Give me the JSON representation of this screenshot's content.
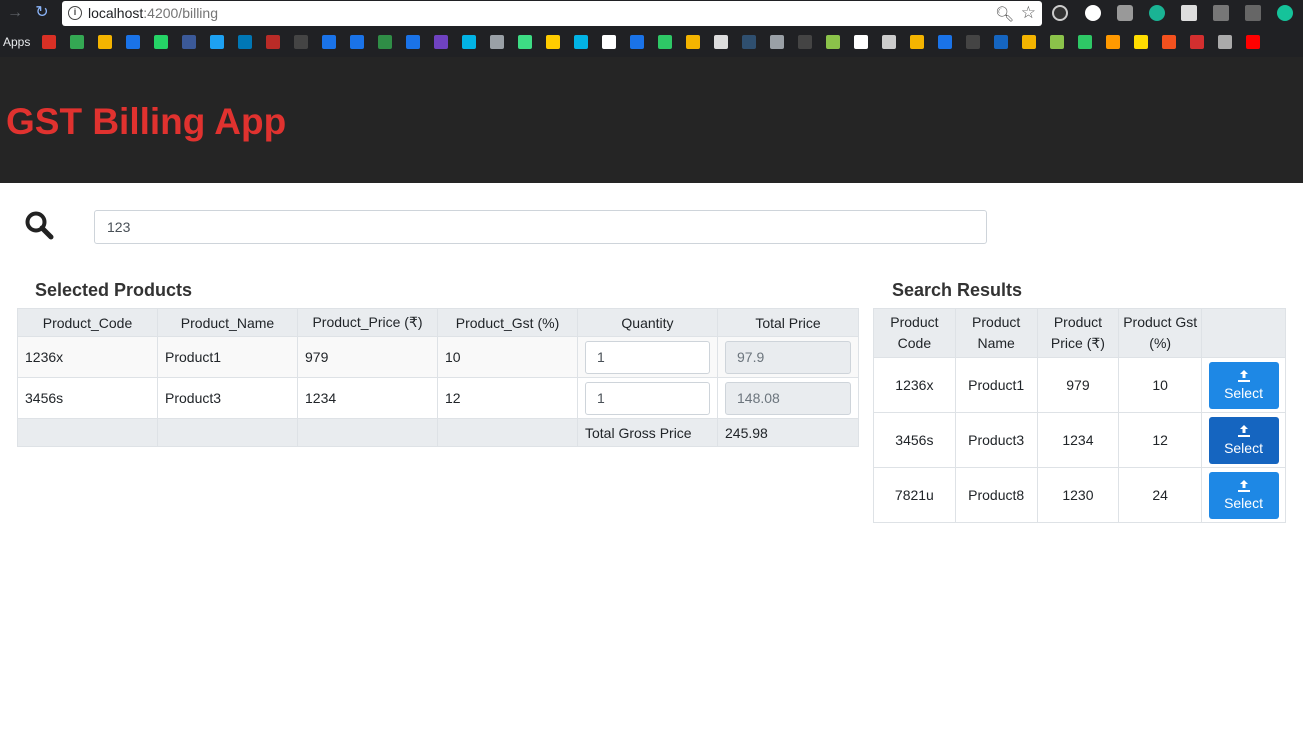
{
  "browser": {
    "url_host": "localhost",
    "url_path": ":4200/billing",
    "apps_label": "Apps"
  },
  "app": {
    "title": "GST Billing App"
  },
  "search": {
    "value": "123"
  },
  "selected": {
    "title": "Selected Products",
    "headers": [
      "Product_Code",
      "Product_Name",
      "Product_Price (₹)",
      "Product_Gst (%)",
      "Quantity",
      "Total Price"
    ],
    "rows": [
      {
        "code": "1236x",
        "name": "Product1",
        "price": "979",
        "gst": "10",
        "qty": "1",
        "total": "97.9"
      },
      {
        "code": "3456s",
        "name": "Product3",
        "price": "1234",
        "gst": "12",
        "qty": "1",
        "total": "148.08"
      }
    ],
    "gross_label": "Total Gross Price",
    "gross_value": "245.98"
  },
  "results": {
    "title": "Search Results",
    "headers": [
      "Product Code",
      "Product Name",
      "Product Price (₹)",
      "Product Gst (%)",
      ""
    ],
    "button_label": "Select",
    "rows": [
      {
        "code": "1236x",
        "name": "Product1",
        "price": "979",
        "gst": "10"
      },
      {
        "code": "3456s",
        "name": "Product3",
        "price": "1234",
        "gst": "12"
      },
      {
        "code": "7821u",
        "name": "Product8",
        "price": "1230",
        "gst": "24"
      }
    ]
  }
}
